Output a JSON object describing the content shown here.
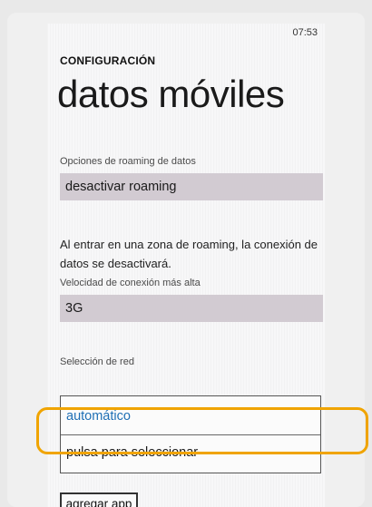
{
  "status": {
    "time": "07:53"
  },
  "header": {
    "app_title": "CONFIGURACIÓN",
    "page_title": "datos móviles"
  },
  "roaming": {
    "label": "Opciones de roaming de datos",
    "value": "desactivar roaming",
    "description": "Al entrar en una zona de roaming, la conexión de datos se desactivará."
  },
  "speed": {
    "label": "Velocidad de conexión más alta",
    "value": "3G"
  },
  "network": {
    "label": "Selección de red",
    "options": [
      "automático",
      "pulsa para seleccionar"
    ],
    "selected_color": "#1f6fb5"
  },
  "actions": {
    "add_app_label": "agregar app"
  },
  "highlight": {
    "color": "#f0a400"
  }
}
